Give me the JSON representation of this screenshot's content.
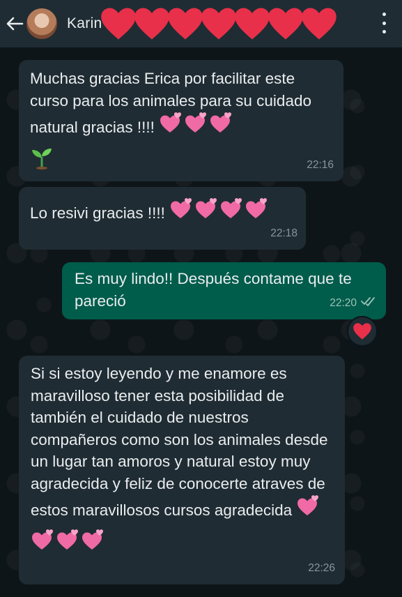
{
  "header": {
    "contact_name": "Karin",
    "back_icon": "arrow-left-icon",
    "menu_icon": "more-vertical-icon"
  },
  "colors": {
    "header_bg": "#1f2c33",
    "incoming_bubble": "#202c33",
    "outgoing_bubble": "#005c4b",
    "chat_bg": "#0b141a",
    "heart_red": "#e8304a",
    "heart_pink": "#f06aa6"
  },
  "messages": [
    {
      "direction": "incoming",
      "text": "Muchas gracias Erica por facilitar este curso para los animales para su cuidado natural gracias !!!!",
      "emoji_after_text": "pink-hearts",
      "extra_emoji": "seedling-icon",
      "time": "22:16"
    },
    {
      "direction": "incoming",
      "text": "Lo resivi gracias !!!!",
      "emoji_after_text": "pink-hearts",
      "time": "22:18"
    },
    {
      "direction": "outgoing",
      "text": "Es muy lindo!! Después contame que te pareció",
      "time": "22:20",
      "status_icon": "double-check-icon",
      "reaction": "red-heart-icon"
    },
    {
      "direction": "incoming",
      "text": "Si si estoy leyendo y me enamore es maravilloso tener esta posibilidad de también el cuidado de nuestros compañeros como son los animales desde un lugar tan amoros y natural estoy muy agradecida y feliz de conocerte atraves de estos maravillosos cursos agradecida",
      "emoji_after_text": "pink-heart",
      "extra_emoji": "pink-hearts",
      "time": "22:26"
    }
  ]
}
